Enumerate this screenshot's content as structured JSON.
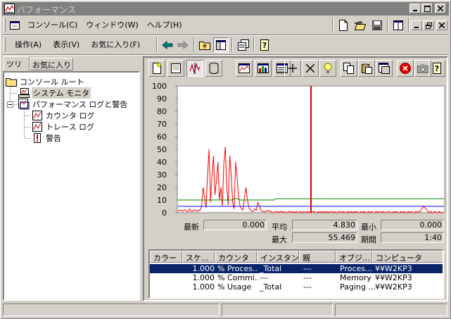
{
  "window": {
    "title": "パフォーマンス"
  },
  "menu": {
    "items": [
      "コンソール(C)",
      "ウィンドウ(W)",
      "ヘルプ(H)"
    ]
  },
  "action_menu": {
    "items": [
      "操作(A)",
      "表示(V)",
      "お気に入り(F)"
    ]
  },
  "tabs": [
    "ツリー",
    "お気に入り"
  ],
  "tree": {
    "root": "コンソール ルート",
    "items": [
      {
        "label": "システム モニタ",
        "indent": 1
      },
      {
        "label": "パフォーマンス ログと警告",
        "indent": 1
      },
      {
        "label": "カウンタ ログ",
        "indent": 2
      },
      {
        "label": "トレース ログ",
        "indent": 2
      },
      {
        "label": "警告",
        "indent": 2
      }
    ]
  },
  "chart_data": {
    "type": "line",
    "ylim": [
      0,
      100
    ],
    "y_ticks": [
      "100",
      "90",
      "80",
      "70",
      "60",
      "50",
      "40",
      "30",
      "20",
      "10",
      "0"
    ],
    "time_bar_position": 0.5,
    "series": [
      {
        "name": "% Processor Time",
        "color": "#ff0000",
        "values": [
          1,
          2,
          2,
          1,
          2,
          2,
          1,
          1,
          3,
          1,
          1,
          2,
          2,
          1,
          2,
          2,
          5,
          20,
          12,
          4,
          30,
          50,
          8,
          30,
          45,
          14,
          25,
          40,
          10,
          20,
          5,
          38,
          52,
          20,
          6,
          45,
          30,
          8,
          3,
          40,
          28,
          12,
          5,
          3,
          2,
          12,
          20,
          10,
          4,
          2,
          1,
          1,
          3,
          2,
          8,
          6,
          2,
          1,
          1,
          1,
          1,
          2,
          1,
          1,
          0,
          0,
          1,
          1,
          0,
          1,
          1,
          0,
          1,
          0,
          0,
          1,
          1,
          0,
          1,
          0,
          1,
          0,
          0,
          1,
          0,
          1,
          1,
          0,
          1,
          0,
          0,
          1,
          1,
          0,
          0,
          1,
          0,
          1,
          0,
          1,
          0,
          1,
          0,
          1,
          1,
          0,
          1,
          0,
          0,
          1,
          1,
          0,
          1,
          0,
          0,
          1,
          0,
          1,
          0,
          1,
          0,
          1,
          0,
          0,
          1,
          0,
          1,
          0,
          0,
          1,
          0,
          1,
          0,
          0,
          1,
          0,
          1,
          1,
          0,
          1,
          0,
          0,
          1,
          1,
          0,
          0,
          1,
          0,
          1,
          0,
          0,
          1,
          0,
          1,
          0,
          0,
          1,
          0,
          1,
          0,
          0,
          1,
          0,
          1,
          1,
          3,
          5,
          4,
          3,
          1,
          0,
          1,
          0,
          0,
          1,
          0,
          0,
          1,
          0,
          0,
          0
        ]
      },
      {
        "name": "% Committed Bytes In Use",
        "color": "#008000",
        "values": [
          10,
          10,
          10,
          10,
          10,
          10,
          10,
          10,
          10,
          10,
          10,
          10,
          10,
          10,
          10,
          10,
          10,
          10,
          10,
          10,
          10,
          10,
          10,
          10,
          10,
          10,
          10,
          10,
          10,
          10,
          10,
          10,
          10,
          10,
          10,
          10,
          10,
          10,
          11,
          11,
          11,
          11,
          10,
          10,
          10,
          10,
          10,
          10,
          10,
          10,
          10,
          10,
          10,
          10,
          10,
          10,
          10,
          10,
          10,
          10,
          10,
          10,
          10,
          10,
          10,
          10,
          11,
          11,
          11,
          11,
          11,
          11,
          11,
          11,
          11,
          11,
          11,
          11,
          11,
          11,
          11,
          11,
          11,
          11,
          11,
          11,
          11,
          11,
          11,
          11,
          11,
          11,
          11,
          11,
          11,
          11,
          11,
          11,
          11,
          11,
          11,
          11,
          11,
          11,
          11,
          11,
          11,
          11,
          11,
          11,
          11,
          11,
          11,
          11,
          11,
          11,
          11,
          11,
          11,
          11,
          11,
          11,
          11,
          11,
          11,
          11,
          11,
          11,
          11,
          11,
          11,
          11,
          11,
          11,
          11,
          11,
          11,
          11,
          11,
          11,
          11,
          11,
          11,
          11,
          11,
          11,
          11,
          11,
          11,
          11,
          11,
          11,
          11,
          11,
          11,
          11,
          11,
          11,
          11,
          11,
          11,
          11,
          11,
          11,
          11,
          11,
          11,
          11,
          11,
          11,
          11,
          11,
          11,
          11,
          11,
          11,
          11,
          11,
          11,
          11,
          11
        ]
      },
      {
        "name": "% Usage",
        "color": "#0000ff",
        "values": [
          5,
          5,
          5,
          5,
          5,
          5,
          5,
          5,
          5,
          5,
          5,
          5,
          5,
          5,
          5,
          5,
          5,
          5,
          5,
          5,
          5,
          5,
          5,
          5,
          5,
          5,
          5,
          5,
          5,
          5,
          5,
          5,
          5,
          5,
          5,
          5,
          5,
          5,
          5,
          5,
          5,
          5,
          5,
          5,
          5,
          5,
          5,
          5,
          5,
          5,
          5,
          5,
          5,
          5,
          5,
          5,
          5,
          5,
          5,
          5,
          5,
          5,
          5,
          5,
          5,
          5,
          5,
          5,
          5,
          5,
          5,
          5,
          5,
          5,
          5,
          5,
          5,
          5,
          5,
          5,
          5,
          5,
          5,
          5,
          5,
          5,
          5,
          5,
          5,
          5,
          5,
          5,
          5,
          5,
          5,
          5,
          5,
          5,
          5,
          5,
          5,
          5,
          5,
          5,
          5,
          5,
          5,
          5,
          5,
          5,
          5,
          5,
          5,
          5,
          5,
          5,
          5,
          5,
          5,
          5,
          5,
          5,
          5,
          5,
          5,
          5,
          5,
          5,
          5,
          5,
          5,
          5,
          5,
          5,
          5,
          5,
          5,
          5,
          5,
          5,
          5,
          5,
          5,
          5,
          5,
          5,
          5,
          5,
          5,
          5,
          5,
          5,
          5,
          5,
          5,
          5,
          5,
          5,
          5,
          5,
          5,
          5,
          5,
          5,
          5,
          5,
          5,
          5,
          5,
          5,
          5,
          5,
          5,
          5,
          5,
          5,
          5,
          5,
          5,
          5,
          5
        ]
      }
    ]
  },
  "stats": {
    "last_label": "最新",
    "last_value": "0.000",
    "avg_label": "平均",
    "avg_value": "4.830",
    "min_label": "最小",
    "min_value": "0.000",
    "max_label": "最大",
    "max_value": "55.469",
    "dur_label": "期間",
    "dur_value": "1:40"
  },
  "legend": {
    "headers": [
      "カラー",
      "スケ...",
      "カウンタ",
      "インスタン...",
      "親",
      "オブジ...",
      "コンピュータ"
    ],
    "rows": [
      {
        "color": "#ff0000",
        "scale": "1.000",
        "counter": "% Proces...",
        "instance": "_Total",
        "parent": "---",
        "object": "Proces...",
        "computer": "¥¥W2KP3",
        "selected": true
      },
      {
        "color": "#008000",
        "scale": "1.000",
        "counter": "% Commi...",
        "instance": "---",
        "parent": "---",
        "object": "Memory",
        "computer": "¥¥W2KP3",
        "selected": false
      },
      {
        "color": "#0000ff",
        "scale": "1.000",
        "counter": "% Usage",
        "instance": "_Total",
        "parent": "---",
        "object": "Paging ...",
        "computer": "¥¥W2KP3",
        "selected": false
      }
    ]
  }
}
